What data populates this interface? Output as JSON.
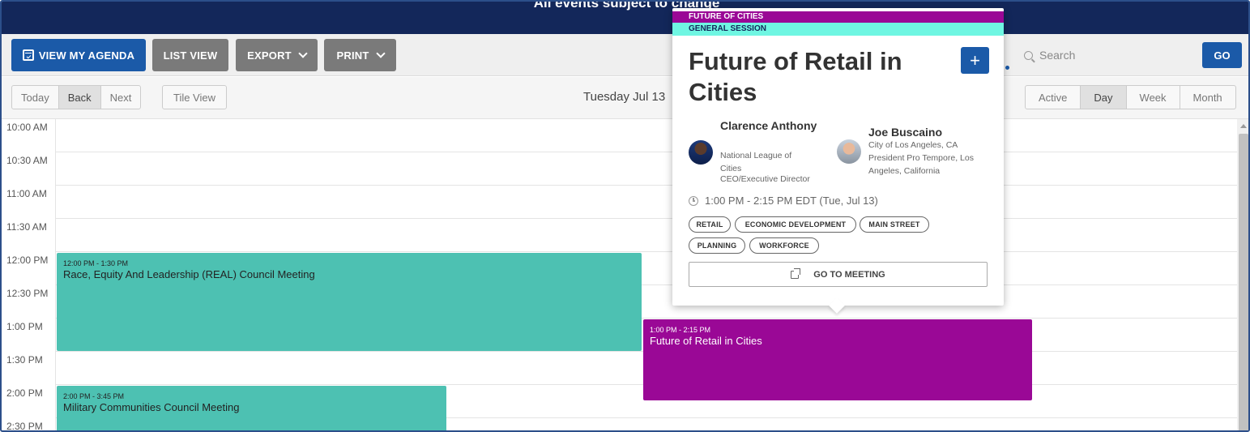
{
  "banner": {
    "text": "All events subject to change"
  },
  "toolbar": {
    "view_agenda": "VIEW MY AGENDA",
    "list_view": "LIST VIEW",
    "export": "EXPORT",
    "print": "PRINT",
    "search_placeholder": "Search",
    "go": "GO"
  },
  "nav": {
    "today": "Today",
    "back": "Back",
    "next": "Next",
    "tile_view": "Tile View",
    "date": "Tuesday Jul 13",
    "views": [
      "Active",
      "Day",
      "Week",
      "Month"
    ],
    "active_view": "Day"
  },
  "times": [
    "10:00 AM",
    "10:30 AM",
    "11:00 AM",
    "11:30 AM",
    "12:00 PM",
    "12:30 PM",
    "1:00 PM",
    "1:30 PM",
    "2:00 PM",
    "2:30 PM"
  ],
  "events": [
    {
      "time": "12:00 PM - 1:30 PM",
      "title": "Race, Equity And Leadership (REAL) Council Meeting",
      "color": "#4dc1b2"
    },
    {
      "time": "1:00 PM - 2:15 PM",
      "title": "Future of Retail in Cities",
      "color": "#9a0896"
    },
    {
      "time": "2:00 PM - 3:45 PM",
      "title": "Military Communities Council Meeting",
      "color": "#4dc1b2"
    }
  ],
  "popup": {
    "track": "FUTURE OF CITIES",
    "session_type": "GENERAL SESSION",
    "title": "Future of Retail in Cities",
    "plus": "+",
    "speakers": [
      {
        "name": "Clarence Anthony",
        "org": "National League of Cities",
        "role": "CEO/Executive Director"
      },
      {
        "name": "Joe Buscaino",
        "org": "City of Los Angeles, CA",
        "role": "President Pro Tempore, Los Angeles, California"
      }
    ],
    "time": "1:00 PM - 2:15 PM EDT (Tue, Jul 13)",
    "tags": [
      "RETAIL",
      "ECONOMIC DEVELOPMENT",
      "MAIN STREET",
      "PLANNING",
      "WORKFORCE"
    ],
    "go_to_meeting": "GO TO MEETING"
  },
  "colors": {
    "navy": "#13275a",
    "primary_blue": "#1b5aa8",
    "teal": "#4dc1b2",
    "purple": "#9a0896",
    "session_cyan": "#6ff6e2"
  }
}
